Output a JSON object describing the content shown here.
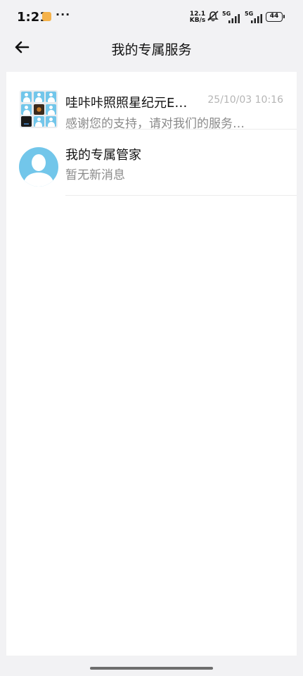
{
  "status_bar": {
    "time": "1:21",
    "more": "···",
    "speed_value": "12.1",
    "speed_unit": "KB/s",
    "network_1": "5G",
    "network_2": "5G",
    "battery": "44"
  },
  "header": {
    "title": "我的专属服务"
  },
  "conversations": [
    {
      "title": "哇咔咔照照星纪元E…",
      "time": "25/10/03 10:16",
      "preview": "感谢您的支持，请对我们的服务…"
    },
    {
      "title": "我的专属管家",
      "preview": "暂无新消息"
    }
  ],
  "colors": {
    "avatar_blue": "#72c6ea",
    "background": "#f2f2f4"
  }
}
